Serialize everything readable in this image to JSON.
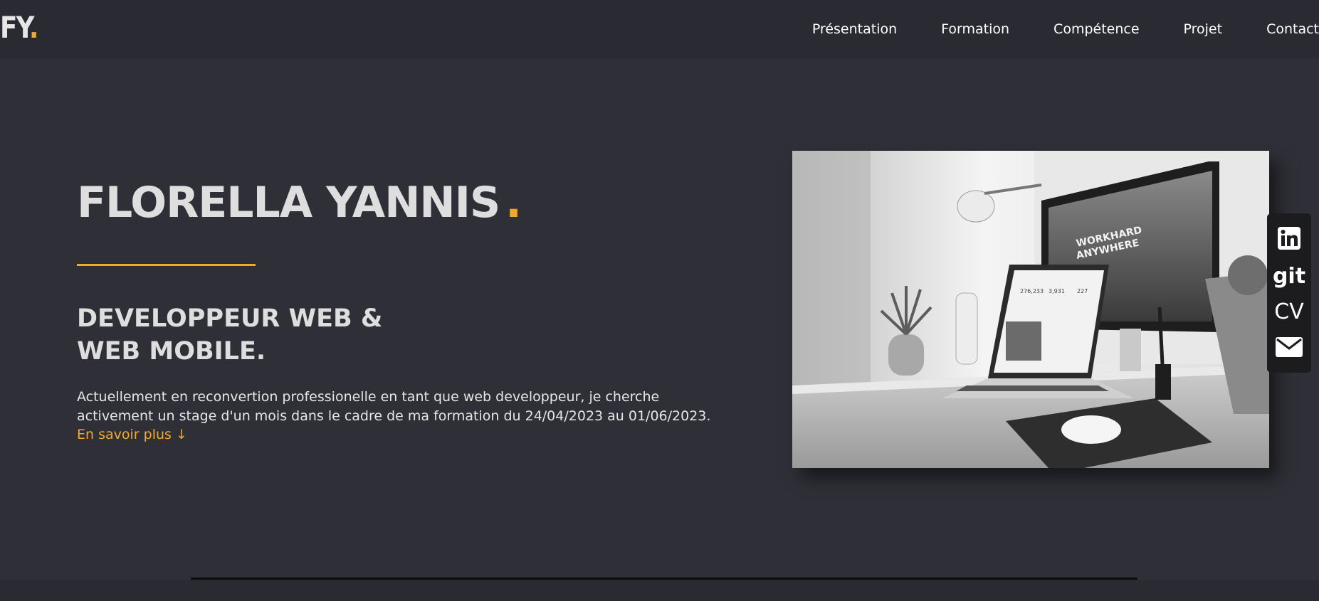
{
  "brand": {
    "letters": "FY",
    "dot": "."
  },
  "nav": {
    "items": [
      "Présentation",
      "Formation",
      "Compétence",
      "Projet",
      "Contact"
    ]
  },
  "hero": {
    "name": "FLORELLA YANNIS",
    "name_dot": ".",
    "subtitle_line1": "DEVELOPPEUR WEB &",
    "subtitle_line2": "WEB MOBILE.",
    "description": "Actuellement en reconvertion professionelle en tant que web developpeur, je cherche activement un stage d'un mois dans le cadre de ma formation du 24/04/2023 au 01/06/2023.",
    "more_link": "En savoir plus ↓"
  },
  "photo": {
    "screen_text_line1": "WORKHARD",
    "screen_text_line2": "ANYWHERE",
    "laptop_stats": [
      "276,233",
      "3,931",
      "227"
    ]
  },
  "social": {
    "linkedin_icon": "linkedin-icon",
    "git_label": "git",
    "cv_label": "CV",
    "mail_icon": "envelope-icon"
  },
  "colors": {
    "background": "#2f3037",
    "navbar": "#2a2b32",
    "accent": "#f0a830",
    "text": "#e6e6e6"
  }
}
